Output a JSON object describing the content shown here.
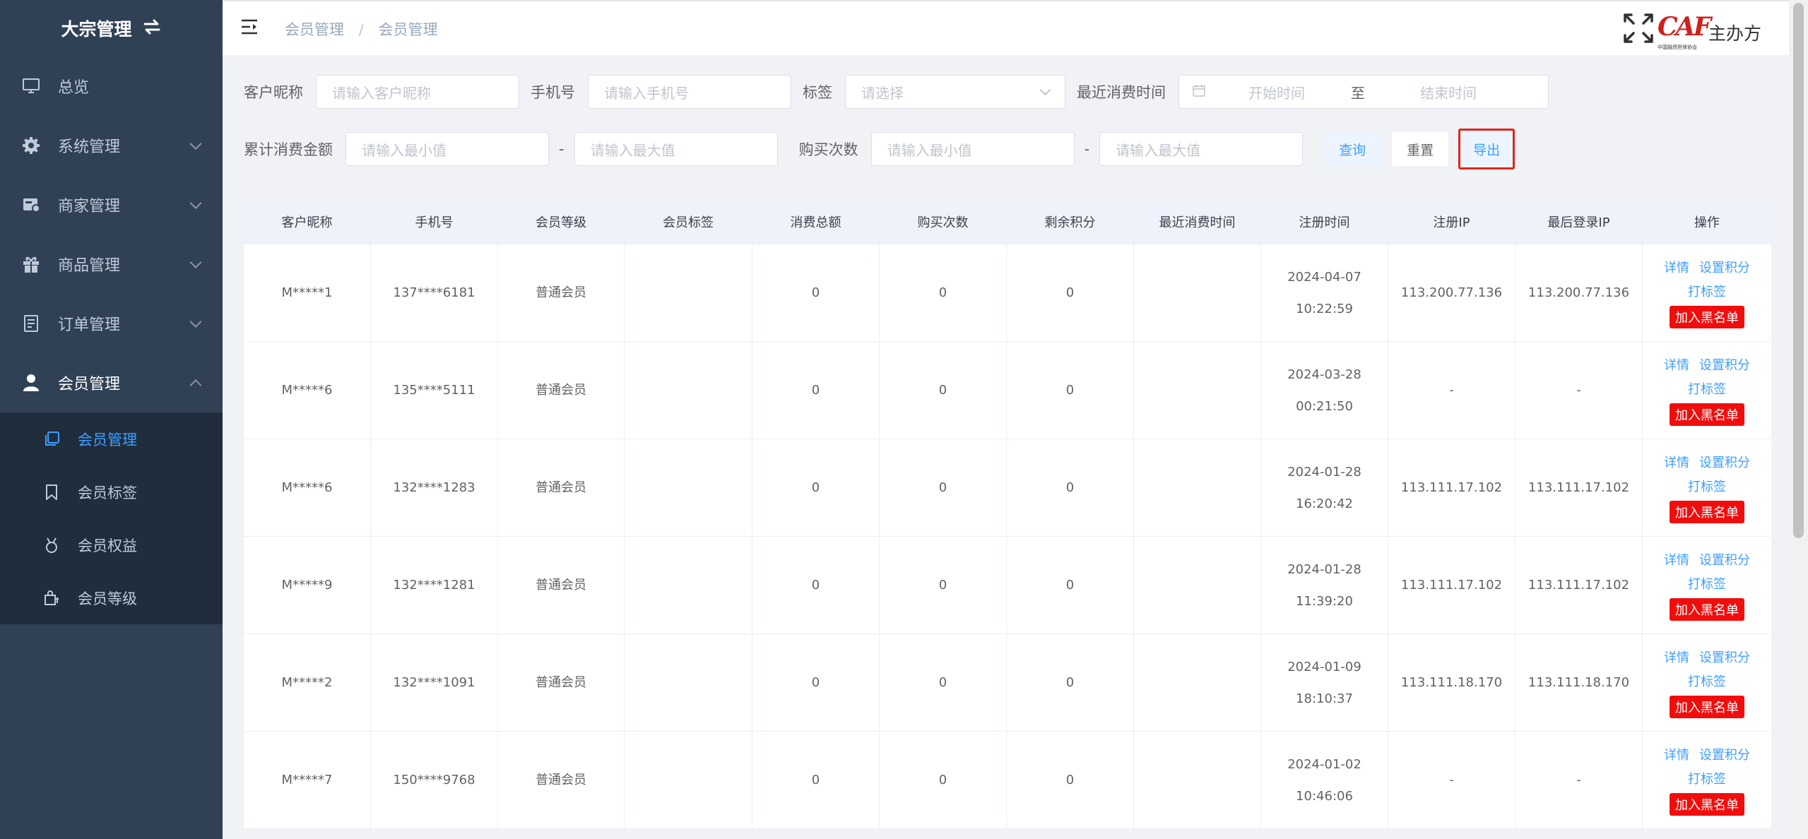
{
  "sidebar": {
    "brand": "大宗管理",
    "brand_icon": "swap-icon",
    "items": [
      {
        "label": "总览",
        "icon": "monitor-icon"
      },
      {
        "label": "系统管理",
        "icon": "gear-icon"
      },
      {
        "label": "商家管理",
        "icon": "store-icon"
      },
      {
        "label": "商品管理",
        "icon": "gift-icon"
      },
      {
        "label": "订单管理",
        "icon": "document-icon"
      },
      {
        "label": "会员管理",
        "icon": "user-icon"
      }
    ],
    "submenu": [
      {
        "label": "会员管理",
        "icon": "copy-icon"
      },
      {
        "label": "会员标签",
        "icon": "bookmark-icon"
      },
      {
        "label": "会员权益",
        "icon": "medal-icon"
      },
      {
        "label": "会员等级",
        "icon": "bag-icon"
      }
    ]
  },
  "header": {
    "breadcrumb": [
      "会员管理",
      "会员管理"
    ],
    "breadcrumb_sep": "/",
    "logo_letters": "CAF",
    "logo_tiny": "中国融资担保协会",
    "org_name": "主办方"
  },
  "filters": {
    "nickname_label": "客户昵称",
    "nickname_placeholder": "请输入客户昵称",
    "phone_label": "手机号",
    "phone_placeholder": "请输入手机号",
    "tag_label": "标签",
    "tag_placeholder": "请选择",
    "recent_label": "最近消费时间",
    "start_placeholder": "开始时间",
    "range_sep": "至",
    "end_placeholder": "结束时间",
    "amount_label": "累计消费金额",
    "min_placeholder": "请输入最小值",
    "max_placeholder": "请输入最大值",
    "dash": "-",
    "count_label": "购买次数",
    "query_btn": "查询",
    "reset_btn": "重置",
    "export_btn": "导出"
  },
  "table": {
    "headers": [
      "客户昵称",
      "手机号",
      "会员等级",
      "会员标签",
      "消费总额",
      "购买次数",
      "剩余积分",
      "最近消费时间",
      "注册时间",
      "注册IP",
      "最后登录IP",
      "操作"
    ],
    "rows": [
      {
        "nickname": "M*****1",
        "phone": "137****6181",
        "level": "普通会员",
        "tag": "",
        "total": "0",
        "count": "0",
        "points": "0",
        "recent": "",
        "reg_time": "2024-04-07 10:22:59",
        "reg_ip": "113.200.77.136",
        "last_ip": "113.200.77.136"
      },
      {
        "nickname": "M*****6",
        "phone": "135****5111",
        "level": "普通会员",
        "tag": "",
        "total": "0",
        "count": "0",
        "points": "0",
        "recent": "",
        "reg_time": "2024-03-28 00:21:50",
        "reg_ip": "-",
        "last_ip": "-"
      },
      {
        "nickname": "M*****6",
        "phone": "132****1283",
        "level": "普通会员",
        "tag": "",
        "total": "0",
        "count": "0",
        "points": "0",
        "recent": "",
        "reg_time": "2024-01-28 16:20:42",
        "reg_ip": "113.111.17.102",
        "last_ip": "113.111.17.102"
      },
      {
        "nickname": "M*****9",
        "phone": "132****1281",
        "level": "普通会员",
        "tag": "",
        "total": "0",
        "count": "0",
        "points": "0",
        "recent": "",
        "reg_time": "2024-01-28 11:39:20",
        "reg_ip": "113.111.17.102",
        "last_ip": "113.111.17.102"
      },
      {
        "nickname": "M*****2",
        "phone": "132****1091",
        "level": "普通会员",
        "tag": "",
        "total": "0",
        "count": "0",
        "points": "0",
        "recent": "",
        "reg_time": "2024-01-09 18:10:37",
        "reg_ip": "113.111.18.170",
        "last_ip": "113.111.18.170"
      },
      {
        "nickname": "M*****7",
        "phone": "150****9768",
        "level": "普通会员",
        "tag": "",
        "total": "0",
        "count": "0",
        "points": "0",
        "recent": "",
        "reg_time": "2024-01-02 10:46:06",
        "reg_ip": "-",
        "last_ip": "-"
      }
    ],
    "actions": {
      "detail": "详情",
      "set_points": "设置积分",
      "tag": "打标签",
      "blacklist": "加入黑名单"
    }
  },
  "colors": {
    "sidebar_bg": "#304156",
    "submenu_bg": "#1f2d3d",
    "accent": "#409eff",
    "danger": "#f20d0d",
    "highlight_border": "#e1251b"
  }
}
